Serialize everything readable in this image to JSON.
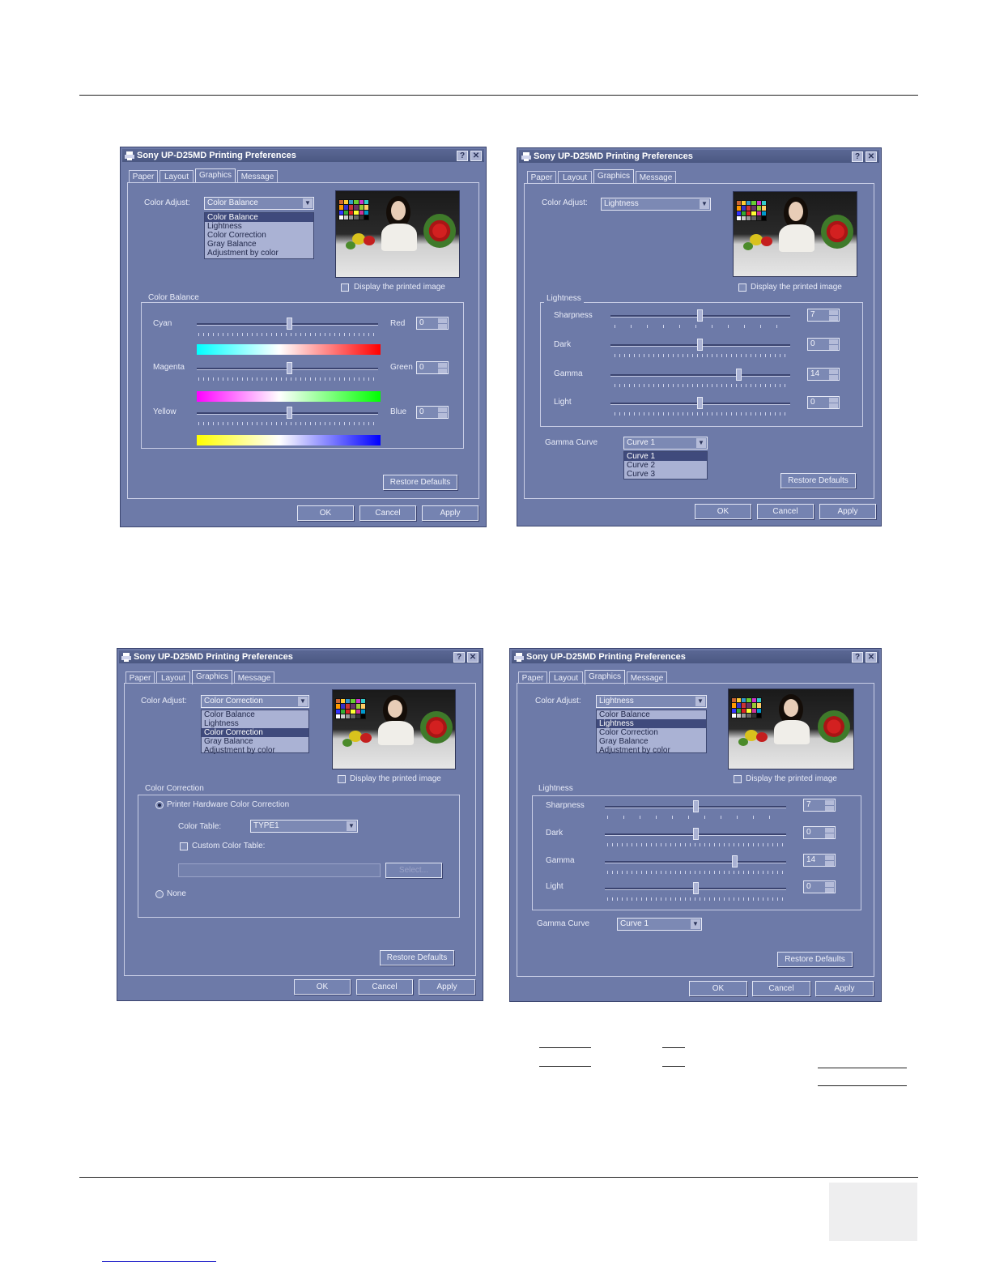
{
  "windows": [
    {
      "title": "Sony UP-D25MD Printing Preferences",
      "tabs": [
        "Paper",
        "Layout",
        "Graphics",
        "Message"
      ],
      "color_adjust_label": "Color Adjust:",
      "color_adjust_value": "Color Balance",
      "color_adjust_options": [
        "Color Balance",
        "Lightness",
        "Color Correction",
        "Gray Balance",
        "Adjustment by color"
      ],
      "display_printed_label": "Display the printed image",
      "group_label": "Color Balance",
      "sliders": [
        {
          "left": "Cyan",
          "right": "Red",
          "value": "0"
        },
        {
          "left": "Magenta",
          "right": "Green",
          "value": "0"
        },
        {
          "left": "Yellow",
          "right": "Blue",
          "value": "0"
        }
      ],
      "restore": "Restore Defaults",
      "ok": "OK",
      "cancel": "Cancel",
      "apply": "Apply"
    },
    {
      "title": "Sony UP-D25MD Printing Preferences",
      "tabs": [
        "Paper",
        "Layout",
        "Graphics",
        "Message"
      ],
      "color_adjust_label": "Color Adjust:",
      "color_adjust_value": "Lightness",
      "display_printed_label": "Display the printed image",
      "group_label": "Lightness",
      "sliders": [
        {
          "label": "Sharpness",
          "value": "7",
          "level": 0.5
        },
        {
          "label": "Dark",
          "value": "0",
          "level": 0.5
        },
        {
          "label": "Gamma",
          "value": "14",
          "level": 0.72
        },
        {
          "label": "Light",
          "value": "0",
          "level": 0.5
        }
      ],
      "gamma_curve_label": "Gamma Curve",
      "gamma_curve_value": "Curve 1",
      "gamma_curve_options": [
        "Curve 1",
        "Curve 2",
        "Curve 3"
      ],
      "restore": "Restore Defaults",
      "ok": "OK",
      "cancel": "Cancel",
      "apply": "Apply"
    },
    {
      "title": "Sony UP-D25MD Printing Preferences",
      "tabs": [
        "Paper",
        "Layout",
        "Graphics",
        "Message"
      ],
      "color_adjust_label": "Color Adjust:",
      "color_adjust_value": "Color Correction",
      "color_adjust_options": [
        "Color Balance",
        "Lightness",
        "Color Correction",
        "Gray Balance",
        "Adjustment by color"
      ],
      "display_printed_label": "Display the printed image",
      "group_label": "Color Correction",
      "printer_hw_label": "Printer Hardware Color Correction",
      "color_table_label": "Color Table:",
      "color_table_value": "TYPE1",
      "custom_table_label": "Custom Color Table:",
      "select_label": "Select...",
      "none_label": "None",
      "restore": "Restore Defaults",
      "ok": "OK",
      "cancel": "Cancel",
      "apply": "Apply"
    },
    {
      "title": "Sony UP-D25MD Printing Preferences",
      "tabs": [
        "Paper",
        "Layout",
        "Graphics",
        "Message"
      ],
      "color_adjust_label": "Color Adjust:",
      "color_adjust_value": "Lightness",
      "color_adjust_options": [
        "Color Balance",
        "Lightness",
        "Color Correction",
        "Gray Balance",
        "Adjustment by color"
      ],
      "display_printed_label": "Display the printed image",
      "group_label": "Lightness",
      "sliders": [
        {
          "label": "Sharpness",
          "value": "7",
          "level": 0.5
        },
        {
          "label": "Dark",
          "value": "0",
          "level": 0.5
        },
        {
          "label": "Gamma",
          "value": "14",
          "level": 0.72
        },
        {
          "label": "Light",
          "value": "0",
          "level": 0.5
        }
      ],
      "gamma_curve_label": "Gamma Curve",
      "gamma_curve_value": "Curve 1",
      "restore": "Restore Defaults",
      "ok": "OK",
      "cancel": "Cancel",
      "apply": "Apply"
    }
  ]
}
